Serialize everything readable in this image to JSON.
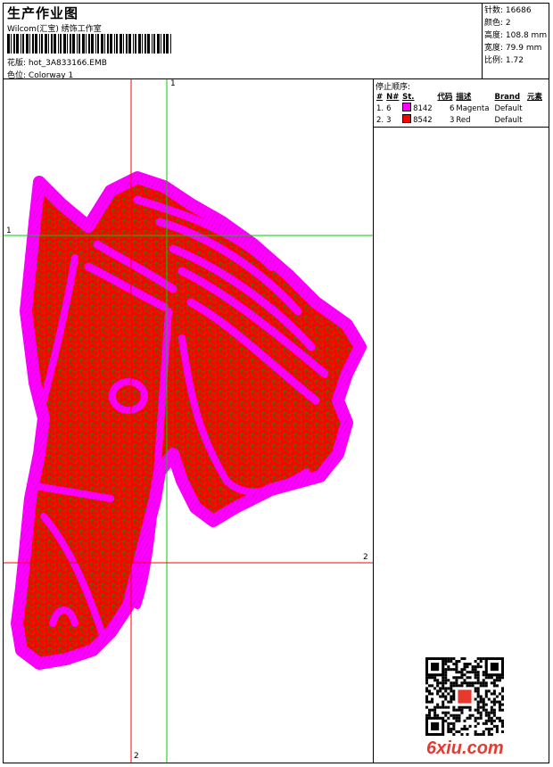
{
  "header": {
    "title": "生产作业图",
    "subtitle": "Wilcom(汇宝) 绣饰工作室",
    "design_label": "花版:",
    "design_file": "hot_3A833166.EMB",
    "colorway_label": "色位:",
    "colorway": "Colorway 1"
  },
  "stats": [
    {
      "label": "针数:",
      "value": "16686"
    },
    {
      "label": "颜色:",
      "value": "2"
    },
    {
      "label": "高度:",
      "value": "108.8 mm"
    },
    {
      "label": "宽度:",
      "value": "79.9 mm"
    },
    {
      "label": "比例:",
      "value": "1.72"
    }
  ],
  "stop_sequence": {
    "label": "停止顺序:",
    "headers": [
      "#",
      "N#",
      "St.",
      "代码",
      "描述",
      "Brand",
      "元素"
    ],
    "rows": [
      {
        "num": "1.",
        "needle": "6",
        "color": "#ff00ff",
        "stitch": "8142",
        "code": "6",
        "desc": "Magenta",
        "brand": "Default"
      },
      {
        "num": "2.",
        "needle": "3",
        "color": "#ff0000",
        "stitch": "8542",
        "code": "3",
        "desc": "Red",
        "brand": "Default"
      }
    ]
  },
  "guides": {
    "green_v": "1",
    "green_h": "1",
    "red_h": "2",
    "red_v": "2"
  },
  "watermark": "6xiu.com",
  "colors": {
    "magenta": "#ff00ff",
    "red": "#ff0000",
    "green": "#00cc00",
    "brand": "#e8392e"
  }
}
